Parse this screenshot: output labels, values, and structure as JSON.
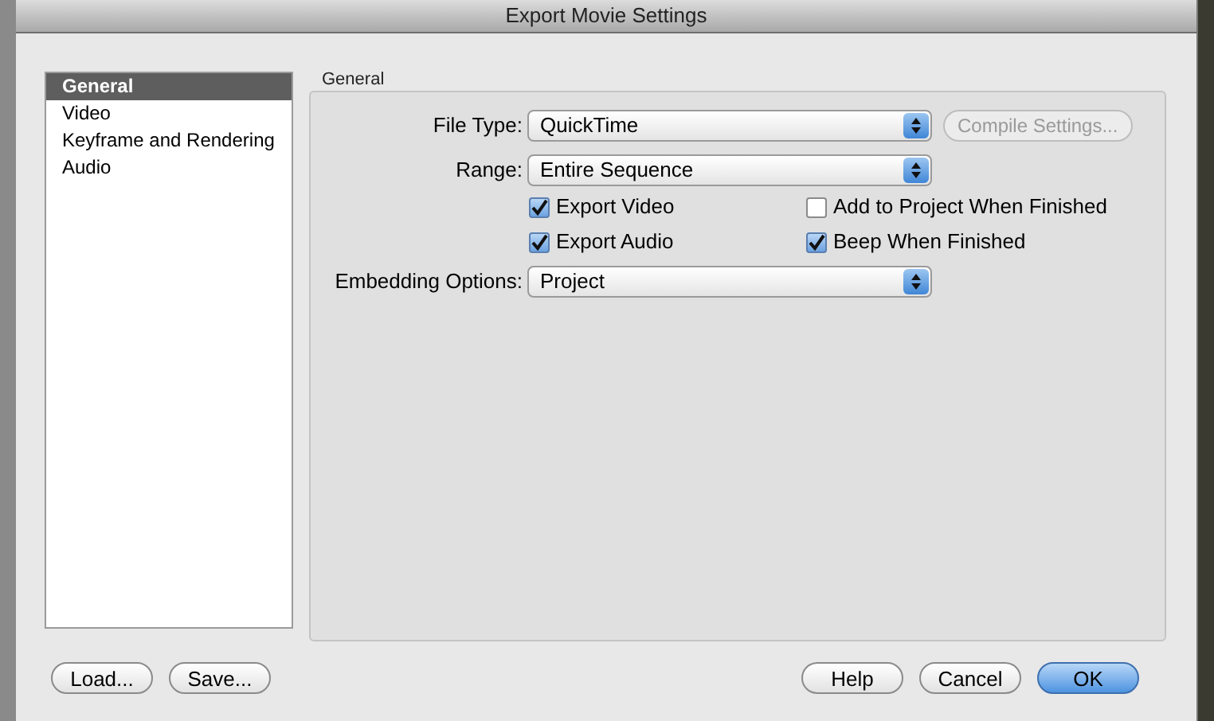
{
  "window": {
    "title": "Export Movie Settings"
  },
  "sidebar": {
    "items": [
      {
        "label": "General",
        "selected": true
      },
      {
        "label": "Video",
        "selected": false
      },
      {
        "label": "Keyframe and Rendering",
        "selected": false
      },
      {
        "label": "Audio",
        "selected": false
      }
    ]
  },
  "panel": {
    "title": "General",
    "file_type": {
      "label": "File Type:",
      "value": "QuickTime"
    },
    "compile_button": {
      "label": "Compile Settings...",
      "disabled": true
    },
    "range": {
      "label": "Range:",
      "value": "Entire Sequence"
    },
    "checkboxes": [
      {
        "label": "Export Video",
        "checked": true
      },
      {
        "label": "Add to Project When Finished",
        "checked": false
      },
      {
        "label": "Export Audio",
        "checked": true
      },
      {
        "label": "Beep When Finished",
        "checked": true
      }
    ],
    "embedding": {
      "label": "Embedding Options:",
      "value": "Project"
    }
  },
  "left_buttons": [
    {
      "label": "Load...",
      "default": false
    },
    {
      "label": "Save...",
      "default": false
    }
  ],
  "right_buttons": [
    {
      "label": "Help",
      "default": false
    },
    {
      "label": "Cancel",
      "default": false
    },
    {
      "label": "OK",
      "default": true
    }
  ]
}
